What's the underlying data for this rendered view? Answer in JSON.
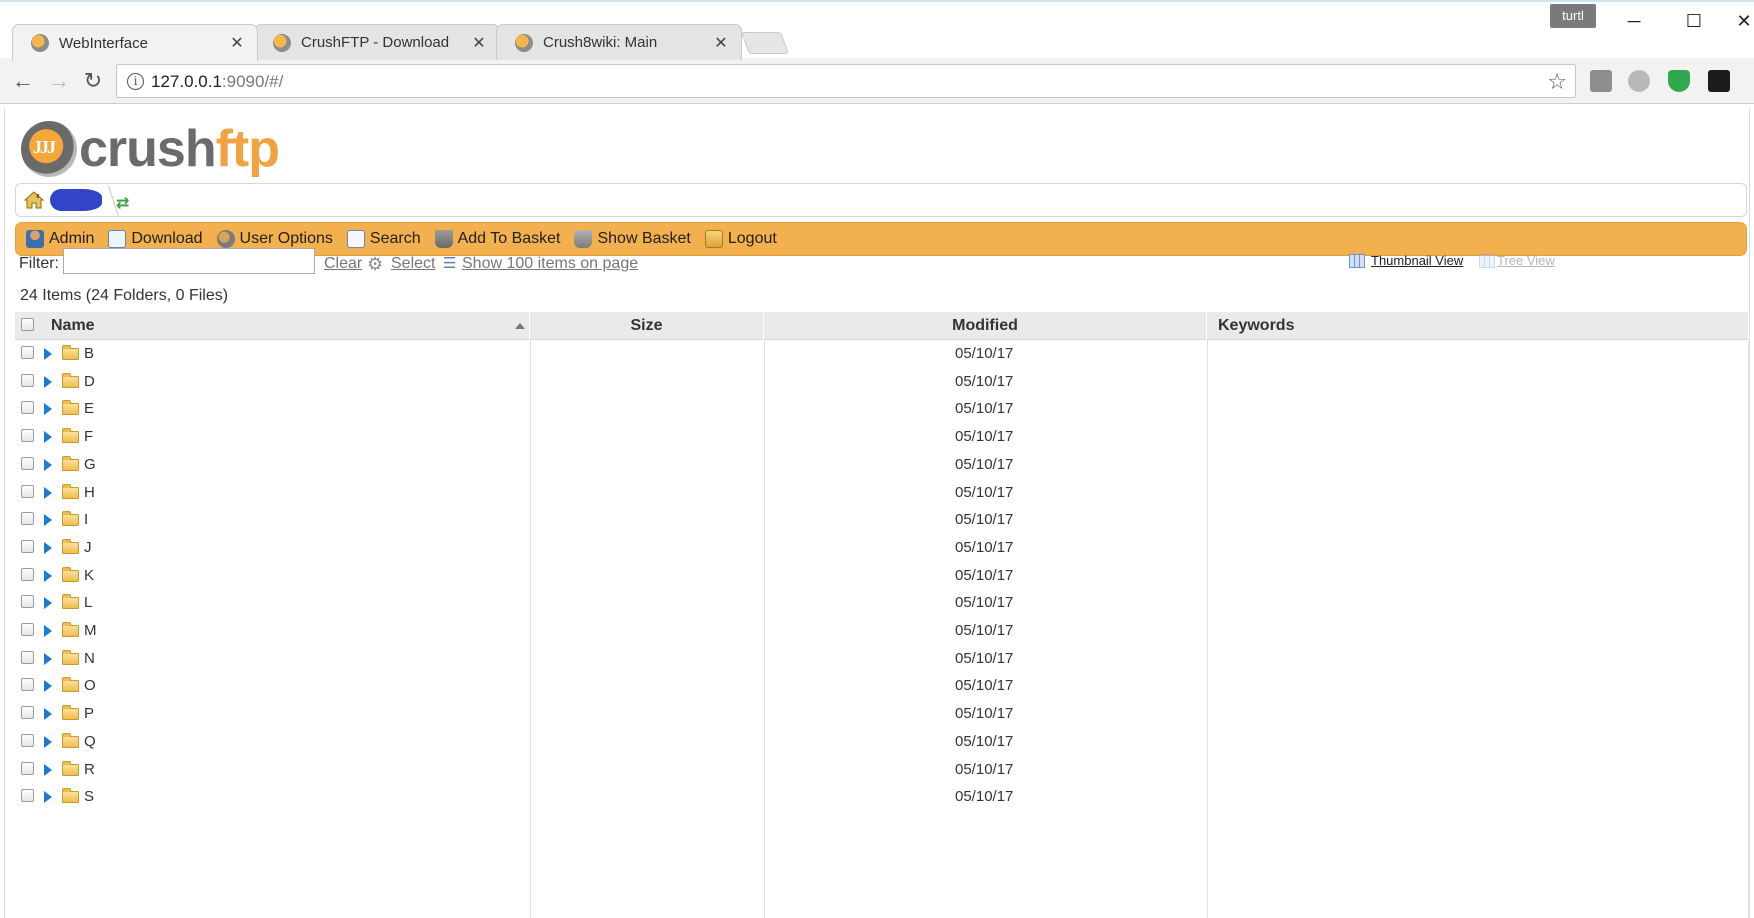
{
  "browser": {
    "tabs": [
      {
        "title": "WebInterface",
        "active": true
      },
      {
        "title": "CrushFTP - Download",
        "active": false
      },
      {
        "title": "Crush8wiki: Main",
        "active": false
      }
    ],
    "profile_label": "turtl",
    "url_host": "127.0.0.1",
    "url_rest": ":9090/#/"
  },
  "app": {
    "logo_part1": "crush",
    "logo_part2": "ftp",
    "accent_color": "#f3b04e"
  },
  "menu": {
    "items": [
      {
        "label": "Admin",
        "icon": "admin-icon"
      },
      {
        "label": "Download",
        "icon": "download-icon"
      },
      {
        "label": "User Options",
        "icon": "user-options-icon"
      },
      {
        "label": "Search",
        "icon": "search-icon"
      },
      {
        "label": "Add To Basket",
        "icon": "add-to-basket-icon"
      },
      {
        "label": "Show Basket",
        "icon": "basket-icon"
      },
      {
        "label": "Logout",
        "icon": "logout-icon"
      }
    ]
  },
  "filter": {
    "label": "Filter:",
    "value": "",
    "clear_label": "Clear",
    "select_label": "Select",
    "show_items_label": "Show 100 items on page",
    "thumbnail_view_label": "Thumbnail View",
    "tree_view_label": "Tree View"
  },
  "summary": "24 Items (24 Folders, 0 Files)",
  "table": {
    "columns": [
      "Name",
      "Size",
      "Modified",
      "Keywords"
    ],
    "sort_column": "Name",
    "rows": [
      {
        "name": "B",
        "size": "",
        "modified": "05/10/17",
        "keywords": ""
      },
      {
        "name": "D",
        "size": "",
        "modified": "05/10/17",
        "keywords": ""
      },
      {
        "name": "E",
        "size": "",
        "modified": "05/10/17",
        "keywords": ""
      },
      {
        "name": "F",
        "size": "",
        "modified": "05/10/17",
        "keywords": ""
      },
      {
        "name": "G",
        "size": "",
        "modified": "05/10/17",
        "keywords": ""
      },
      {
        "name": "H",
        "size": "",
        "modified": "05/10/17",
        "keywords": ""
      },
      {
        "name": "I",
        "size": "",
        "modified": "05/10/17",
        "keywords": ""
      },
      {
        "name": "J",
        "size": "",
        "modified": "05/10/17",
        "keywords": ""
      },
      {
        "name": "K",
        "size": "",
        "modified": "05/10/17",
        "keywords": ""
      },
      {
        "name": "L",
        "size": "",
        "modified": "05/10/17",
        "keywords": ""
      },
      {
        "name": "M",
        "size": "",
        "modified": "05/10/17",
        "keywords": ""
      },
      {
        "name": "N",
        "size": "",
        "modified": "05/10/17",
        "keywords": ""
      },
      {
        "name": "O",
        "size": "",
        "modified": "05/10/17",
        "keywords": ""
      },
      {
        "name": "P",
        "size": "",
        "modified": "05/10/17",
        "keywords": ""
      },
      {
        "name": "Q",
        "size": "",
        "modified": "05/10/17",
        "keywords": ""
      },
      {
        "name": "R",
        "size": "",
        "modified": "05/10/17",
        "keywords": ""
      },
      {
        "name": "S",
        "size": "",
        "modified": "05/10/17",
        "keywords": ""
      }
    ]
  }
}
